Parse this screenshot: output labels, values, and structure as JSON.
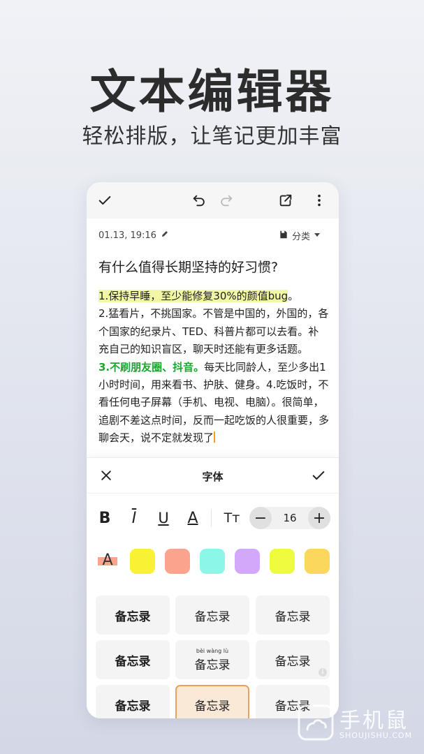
{
  "hero": {
    "title": "文本编辑器",
    "subtitle": "轻松排版，让笔记更加丰富"
  },
  "note": {
    "timestamp": "01.13, 19:16",
    "category": "分类",
    "title": "有什么值得长期坚持的好习惯?",
    "highlight_line": "1.保持早睡，至少能修复30%的颜值bug",
    "highlight_end": "。",
    "para2": "2.猛看片，不挑国家。不管是中国的，外国的，各个国家的纪录片、TED、科普片都可以去看。补充自己的知识盲区，聊天时还能有更多话题。",
    "green_text": "3.不刷朋友圈、抖音。",
    "para3": "每天比同龄人，至少多出1小时时间，用来看书、护肤、健身。4.吃饭时，不看任何电子屏幕（手机、电视、电脑）。很简单，追剧不差这点时间，反而一起吃饭的人很重要，多聊会天，说不定就发现了"
  },
  "font_panel": {
    "title": "字体",
    "bold": "B",
    "italic": "I",
    "underline": "U",
    "font_color": "A",
    "text_size": "Tт",
    "size_value": "16",
    "decrease": "−",
    "increase": "+",
    "highlight_label": "A",
    "swatch_colors": [
      "#f9f134",
      "#fba38c",
      "#8cf6e9",
      "#d3a8fa",
      "#eefb3e",
      "#fbd85c"
    ],
    "font_samples": [
      "备忘录",
      "备忘录",
      "备忘录",
      "备忘录",
      "备忘录",
      "备忘录",
      "备忘录",
      "备忘录",
      "备忘录"
    ],
    "pinyin": "bèi wàng lù",
    "selected_index": 7
  },
  "watermark": {
    "brand": "手机鼠",
    "url": "SHOUJISHU.COM"
  }
}
